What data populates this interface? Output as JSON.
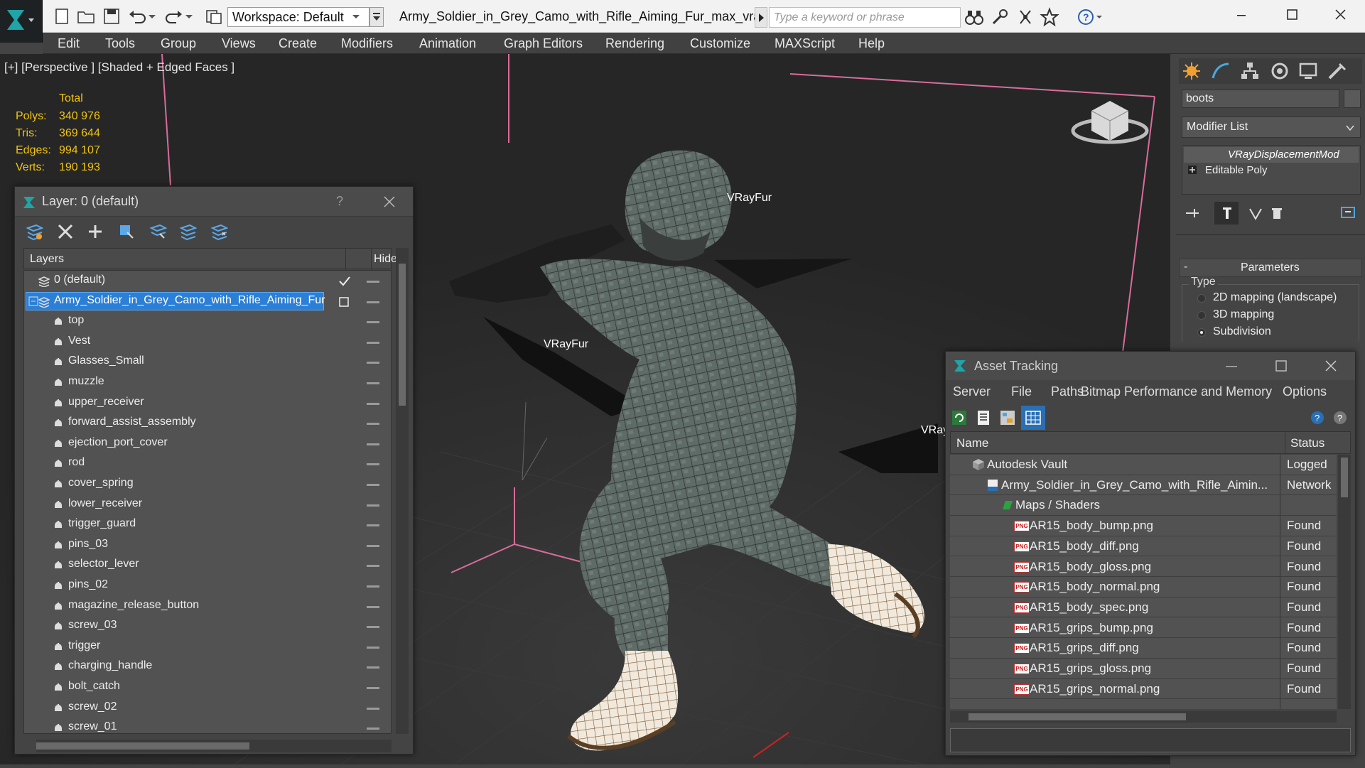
{
  "titlebar": {
    "workspace": "Workspace: Default",
    "title": "Army_Soldier_in_Grey_Camo_with_Rifle_Aiming_Fur_max_vra...",
    "search_placeholder": "Type a keyword or phrase"
  },
  "menu": [
    "Edit",
    "Tools",
    "Group",
    "Views",
    "Create",
    "Modifiers",
    "Animation",
    "Graph Editors",
    "Rendering",
    "Customize",
    "MAXScript",
    "Help"
  ],
  "viewport": {
    "label": "[+] [Perspective ] [Shaded + Edged Faces ]",
    "stats_header": "Total",
    "stats": [
      {
        "label": "Polys:",
        "value": "340 976"
      },
      {
        "label": "Tris:",
        "value": "369 644"
      },
      {
        "label": "Edges:",
        "value": "994 107"
      },
      {
        "label": "Verts:",
        "value": "190 193"
      }
    ],
    "fur_labels": [
      "VRayFur",
      "VRayFur",
      "VRay"
    ]
  },
  "command_panel": {
    "object_name": "boots",
    "modifier_list": "Modifier List",
    "stack": [
      "VRayDisplacementMod",
      "Editable Poly"
    ],
    "rollout_title": "Parameters",
    "type_label": "Type",
    "options": [
      "2D mapping (landscape)",
      "3D mapping",
      "Subdivision"
    ],
    "selected_option": "Subdivision"
  },
  "layer_dialog": {
    "title": "Layer: 0 (default)",
    "help": "?",
    "col_layers": "Layers",
    "col_hide": "Hide",
    "rows": [
      {
        "name": "0 (default)",
        "level": 0,
        "type": "layer"
      },
      {
        "name": "Army_Soldier_in_Grey_Camo_with_Rifle_Aiming_Fur",
        "level": 0,
        "type": "layer",
        "selected": true
      },
      {
        "name": "top",
        "level": 1,
        "type": "object"
      },
      {
        "name": "Vest",
        "level": 1,
        "type": "object"
      },
      {
        "name": "Glasses_Small",
        "level": 1,
        "type": "object"
      },
      {
        "name": "muzzle",
        "level": 1,
        "type": "object"
      },
      {
        "name": "upper_receiver",
        "level": 1,
        "type": "object"
      },
      {
        "name": "forward_assist_assembly",
        "level": 1,
        "type": "object"
      },
      {
        "name": "ejection_port_cover",
        "level": 1,
        "type": "object"
      },
      {
        "name": "rod",
        "level": 1,
        "type": "object"
      },
      {
        "name": "cover_spring",
        "level": 1,
        "type": "object"
      },
      {
        "name": "lower_receiver",
        "level": 1,
        "type": "object"
      },
      {
        "name": "trigger_guard",
        "level": 1,
        "type": "object"
      },
      {
        "name": "pins_03",
        "level": 1,
        "type": "object"
      },
      {
        "name": "selector_lever",
        "level": 1,
        "type": "object"
      },
      {
        "name": "pins_02",
        "level": 1,
        "type": "object"
      },
      {
        "name": "magazine_release_button",
        "level": 1,
        "type": "object"
      },
      {
        "name": "screw_03",
        "level": 1,
        "type": "object"
      },
      {
        "name": "trigger",
        "level": 1,
        "type": "object"
      },
      {
        "name": "charging_handle",
        "level": 1,
        "type": "object"
      },
      {
        "name": "bolt_catch",
        "level": 1,
        "type": "object"
      },
      {
        "name": "screw_02",
        "level": 1,
        "type": "object"
      },
      {
        "name": "screw_01",
        "level": 1,
        "type": "object"
      }
    ]
  },
  "asset_dialog": {
    "title": "Asset Tracking",
    "menu": [
      "Server",
      "File",
      "Paths",
      "Bitmap Performance and Memory",
      "Options"
    ],
    "col_name": "Name",
    "col_status": "Status",
    "rows": [
      {
        "name": "Autodesk Vault",
        "status": "Logged",
        "level": 0,
        "icon": "vault"
      },
      {
        "name": "Army_Soldier_in_Grey_Camo_with_Rifle_Aimin...",
        "status": "Network",
        "level": 1,
        "icon": "max"
      },
      {
        "name": "Maps / Shaders",
        "status": "",
        "level": 2,
        "icon": "maps"
      },
      {
        "name": "AR15_body_bump.png",
        "status": "Found",
        "level": 3,
        "icon": "png"
      },
      {
        "name": "AR15_body_diff.png",
        "status": "Found",
        "level": 3,
        "icon": "png"
      },
      {
        "name": "AR15_body_gloss.png",
        "status": "Found",
        "level": 3,
        "icon": "png"
      },
      {
        "name": "AR15_body_normal.png",
        "status": "Found",
        "level": 3,
        "icon": "png"
      },
      {
        "name": "AR15_body_spec.png",
        "status": "Found",
        "level": 3,
        "icon": "png"
      },
      {
        "name": "AR15_grips_bump.png",
        "status": "Found",
        "level": 3,
        "icon": "png"
      },
      {
        "name": "AR15_grips_diff.png",
        "status": "Found",
        "level": 3,
        "icon": "png"
      },
      {
        "name": "AR15_grips_gloss.png",
        "status": "Found",
        "level": 3,
        "icon": "png"
      },
      {
        "name": "AR15_grips_normal.png",
        "status": "Found",
        "level": 3,
        "icon": "png"
      }
    ],
    "png_badge": "PNG"
  }
}
